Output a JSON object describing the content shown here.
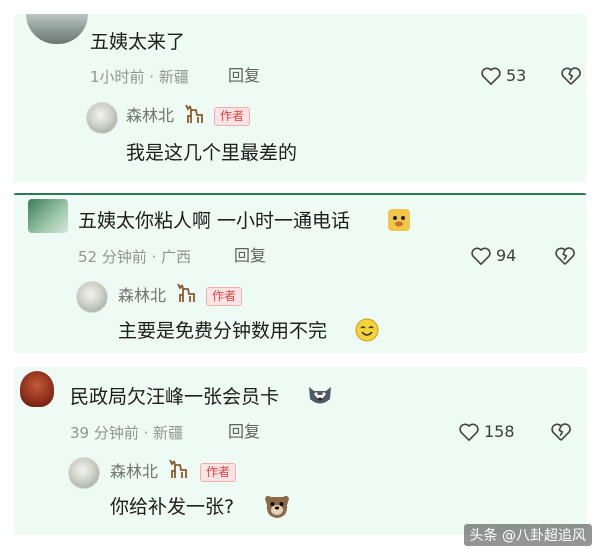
{
  "comments": [
    {
      "text": "五姨太来了",
      "meta": "1小时前 · 新疆",
      "reply_label": "回复",
      "likes": "53",
      "reply": {
        "author": "森林北",
        "badge": "作者",
        "text": "我是这几个里最差的"
      }
    },
    {
      "text": "五姨太你粘人啊 一小时一通电话",
      "meta": "52 分钟前 · 广西",
      "reply_label": "回复",
      "likes": "94",
      "reply": {
        "author": "森林北",
        "badge": "作者",
        "text": "主要是免费分钟数用不完"
      }
    },
    {
      "text": "民政局欠汪峰一张会员卡",
      "meta": "39 分钟前 · 新疆",
      "reply_label": "回复",
      "likes": "158",
      "reply": {
        "author": "森林北",
        "badge": "作者",
        "text": "你给补发一张?"
      }
    }
  ],
  "watermark": "头条 @八卦超追风",
  "colors": {
    "card_bg": "#eefaf4",
    "badge_red": "#e04040",
    "meta_gray": "#8f9693"
  },
  "icons": [
    "heart-icon",
    "broken-heart-icon",
    "deer-icon",
    "bear-emoji",
    "smile-emoji",
    "husky-emoji",
    "dog-emoji"
  ]
}
